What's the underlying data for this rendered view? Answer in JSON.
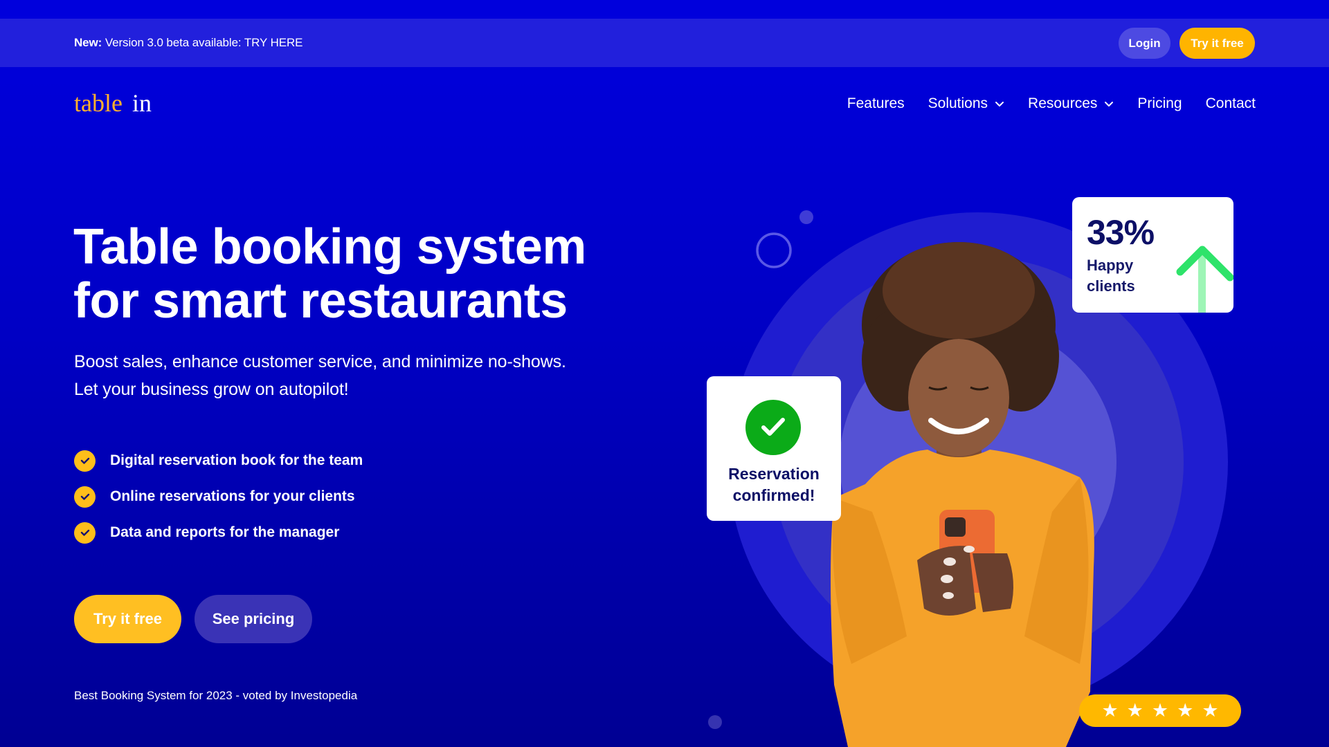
{
  "banner": {
    "label_bold": "New:",
    "text": " Version 3.0 beta available: TRY HERE",
    "login_label": "Login",
    "try_label": "Try it free"
  },
  "logo": {
    "part1": "table",
    "part2": "in"
  },
  "nav": {
    "items": [
      {
        "label": "Features",
        "has_dropdown": false
      },
      {
        "label": "Solutions",
        "has_dropdown": true
      },
      {
        "label": "Resources",
        "has_dropdown": true
      },
      {
        "label": "Pricing",
        "has_dropdown": false
      },
      {
        "label": "Contact",
        "has_dropdown": false
      }
    ]
  },
  "hero": {
    "title_line1": "Table booking system",
    "title_line2": "for smart restaurants",
    "lead_line1": "Boost sales, enhance customer service, and minimize no-shows.",
    "lead_line2": "Let your business grow on autopilot!",
    "features": [
      "Digital reservation book for the team",
      "Online reservations for your clients",
      "Data and reports for the manager"
    ],
    "cta_primary": "Try it free",
    "cta_secondary": "See pricing",
    "award": "Best Booking System for 2023 - voted by Investopedia"
  },
  "illustration": {
    "stat_value": "33%",
    "stat_label_line1": "Happy",
    "stat_label_line2": "clients",
    "stat_icon": "arrow-up-icon",
    "reservation_icon": "check-circle-icon",
    "reservation_line1": "Reservation",
    "reservation_line2": "confirmed!",
    "rating_stars": 5,
    "rating_star_glyph": "★"
  },
  "colors": {
    "brand_yellow": "#ffb800",
    "background_top": "#0000de",
    "background_bottom": "#000093",
    "banner": "#2220dc",
    "success_green": "#0bab18",
    "arrow_green": "#2ee36a",
    "text_navy": "#0c0f66"
  }
}
